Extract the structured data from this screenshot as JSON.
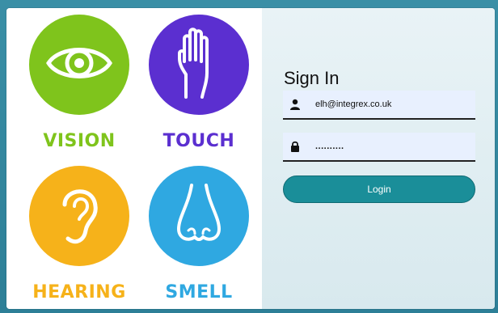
{
  "senses": [
    {
      "label": "VISION",
      "color": "#7fc41c",
      "icon": "eye-icon"
    },
    {
      "label": "TOUCH",
      "color": "#5b2fd0",
      "icon": "hand-icon"
    },
    {
      "label": "HEARING",
      "color": "#f6b21a",
      "icon": "ear-icon"
    },
    {
      "label": "SMELL",
      "color": "#2fa8e1",
      "icon": "nose-icon"
    }
  ],
  "signin": {
    "title": "Sign In",
    "email_value": "elh@integrex.co.uk",
    "password_value": "..........",
    "login_label": "Login"
  },
  "colors": {
    "accent": "#1a8e99",
    "field_bg": "#e8f0fe"
  }
}
